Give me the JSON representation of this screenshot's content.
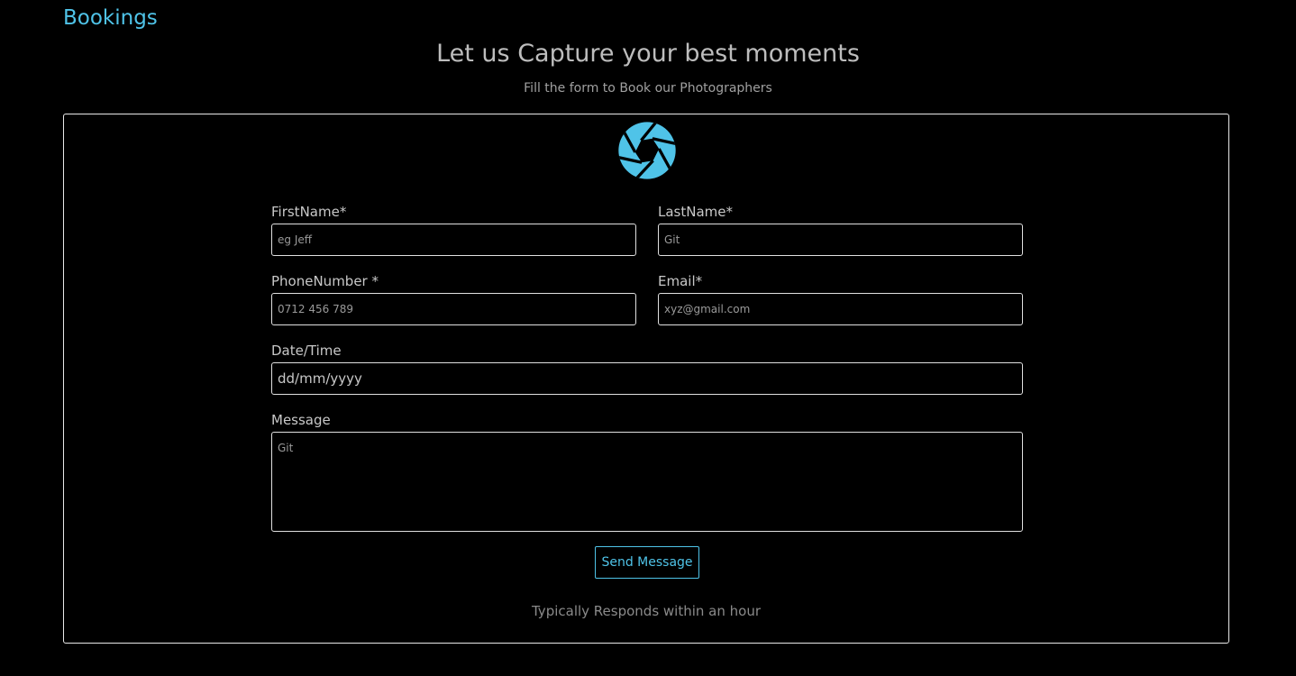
{
  "section": {
    "title": "Bookings"
  },
  "hero": {
    "headline": "Let us Capture your best moments",
    "subline": "Fill the form to Book our Photographers"
  },
  "form": {
    "logo_icon": "camera-aperture-icon",
    "first_name": {
      "label": "FirstName*",
      "placeholder": "eg Jeff"
    },
    "last_name": {
      "label": "LastName*",
      "placeholder": "Git"
    },
    "phone": {
      "label": "PhoneNumber *",
      "placeholder": "0712 456 789"
    },
    "email": {
      "label": "Email*",
      "placeholder": "xyz@gmail.com"
    },
    "datetime": {
      "label": "Date/Time",
      "value": "dd/mm/yyyy"
    },
    "message": {
      "label": "Message",
      "placeholder": "Git"
    },
    "submit_label": "Send Message",
    "response_note": "Typically Responds within an hour"
  },
  "colors": {
    "accent": "#4fc3e8",
    "background": "#000000",
    "border": "#e0e0e0"
  }
}
